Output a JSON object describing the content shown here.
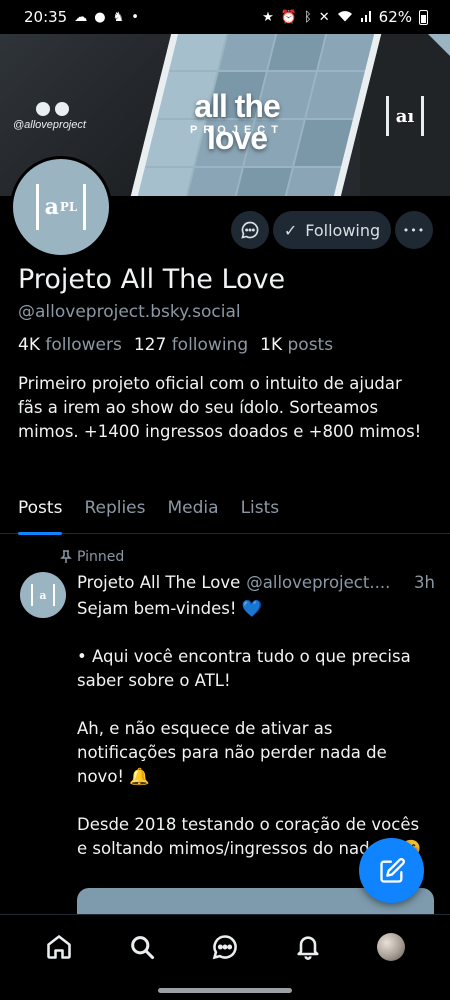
{
  "status_bar": {
    "time": "20:35",
    "left_icons": [
      "cloud-icon",
      "chat-bubble-icon",
      "app-icon",
      "dot-icon"
    ],
    "right_icons": [
      "star-icon",
      "alarm-icon",
      "bluetooth-icon",
      "mute-icon",
      "wifi-icon",
      "signal-icon"
    ],
    "battery": "62%"
  },
  "banner": {
    "title": "all the love",
    "subtitle": "PROJECT",
    "handle": "@alloveproject",
    "logo_text": "aı"
  },
  "profile": {
    "name": "Projeto All The Love",
    "handle": "@alloveproject.bsky.social",
    "followers_count": "4K",
    "followers_label": "followers",
    "following_count": "127",
    "following_label": "following",
    "posts_count": "1K",
    "posts_label": "posts",
    "bio": "Primeiro projeto oficial com o intuito de ajudar fãs a irem ao show do seu ídolo. Sorteamos mimos. +1400 ingressos doados e +800 mimos!"
  },
  "actions": {
    "following_label": "Following",
    "more_label": "•••"
  },
  "tabs": [
    {
      "label": "Posts",
      "active": true
    },
    {
      "label": "Replies",
      "active": false
    },
    {
      "label": "Media",
      "active": false
    },
    {
      "label": "Lists",
      "active": false
    }
  ],
  "post": {
    "pinned_label": "Pinned",
    "author": "Projeto All The Love",
    "handle": "@alloveproject....",
    "time": "3h",
    "line1": "Sejam bem-vindes! 💙",
    "line2": "•  Aqui você encontra tudo o que precisa saber sobre o ATL!",
    "line3": "Ah, e não esquece de ativar as notificações para não perder nada de novo!  🔔",
    "line4": "Desde 2018 testando o coração de vocês e soltando mimos/ingressos do nada... 🤭"
  },
  "colors": {
    "accent": "#1083fe",
    "muted_text": "#8b98a5",
    "button_bg": "#1f2933",
    "brand_blue": "#9ab4c2"
  },
  "bottom_nav": [
    "home-icon",
    "search-icon",
    "chat-icon",
    "bell-icon",
    "profile-avatar"
  ]
}
